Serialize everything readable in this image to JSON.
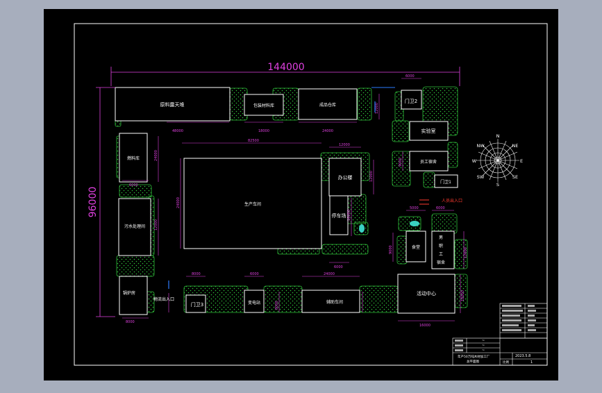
{
  "colors": {
    "background": "#a7aebd",
    "canvas": "#000000",
    "frame": "#ffffff",
    "building": "#ffffff",
    "green": "#2fbf3a",
    "dimension": "#e040e0",
    "text": "#ffffff",
    "accent_blue": "#2d7cff",
    "accent_red": "#ff3b30",
    "pond": "#3ad1c2"
  },
  "drawing": {
    "overall_width": "144000",
    "overall_height": "96000"
  },
  "buildings": {
    "raw_storage": "原料露天堆",
    "aux_material": "包装材料库",
    "product_warehouse": "成品仓库",
    "gate2": "门卫2",
    "lab": "实验室",
    "staff_dorm": "员工宿舍",
    "gate1": "门卫1",
    "people_entrance": "人员出入口",
    "fuel_store": "燃料库",
    "main_workshop": "生产车间",
    "office": "办公楼",
    "garage": "停车场",
    "sewage": "污水处理间",
    "canteen": "食堂",
    "staff_dorm2_line1": "男",
    "staff_dorm2_line2": "职",
    "staff_dorm2_line3": "工",
    "staff_dorm2_line4": "宿舍",
    "boiler": "锅炉房",
    "goods_entrance": "物流出入口",
    "gate3": "门卫3",
    "power_room": "变电站",
    "aux_workshop": "辅助车间",
    "activity_center": "活动中心"
  },
  "dims": {
    "d1": "48000",
    "d2": "18000",
    "d3": "24000",
    "d4": "6000",
    "d5": "9000",
    "d6": "82500",
    "d7": "12000",
    "d8": "6000",
    "d9": "24000",
    "d10": "12000",
    "d11": "6000",
    "d12": "8000",
    "d13": "16000",
    "d14": "24000",
    "d15": "8000",
    "d16": "12000",
    "d17": "9000",
    "d18": "6000",
    "d19": "12000",
    "d20": "9000",
    "d21": "16000",
    "d22": "5000",
    "d23": "6000",
    "d24": "12000",
    "d25": "18000",
    "d26": "8000"
  },
  "compass": {
    "n": "N",
    "ne": "NE",
    "e": "E",
    "se": "SE",
    "s": "S",
    "sw": "SW",
    "w": "W",
    "nw": "NW"
  },
  "title_block": {
    "date": "2023.5.8",
    "sheet_label": "比例",
    "sheet_value": "1",
    "drawing_title_line1": "年产50万吨木材加工厂",
    "drawing_title_line2": "总平面图",
    "tb1": "~",
    "tb2": "~",
    "tb3": "~"
  }
}
